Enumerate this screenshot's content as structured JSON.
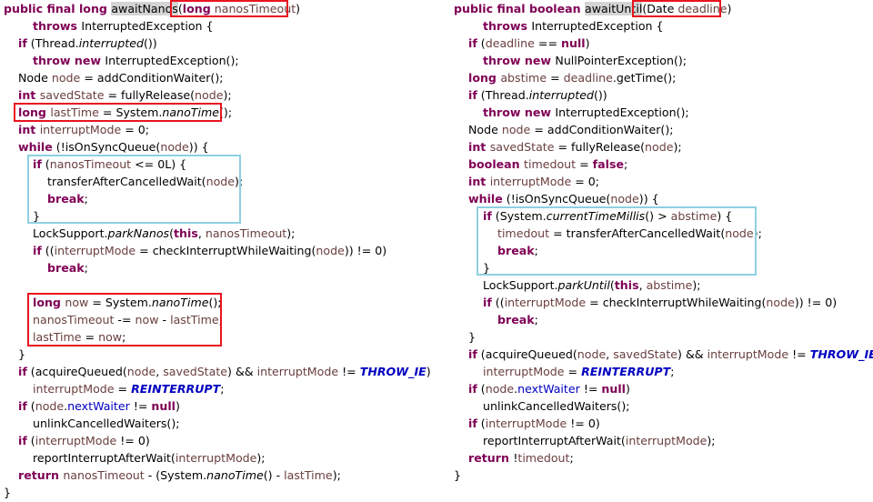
{
  "left": {
    "lines": [
      {
        "indent": 0,
        "tokens": [
          [
            "kw",
            "public final long "
          ],
          [
            "sel",
            "awaitNanos"
          ],
          [
            "",
            "("
          ],
          [
            "kw",
            "long"
          ],
          [
            "var",
            " nanosTimeout"
          ],
          [
            "",
            ")"
          ]
        ]
      },
      {
        "indent": 2,
        "tokens": [
          [
            "kw",
            "throws "
          ],
          [
            "",
            "InterruptedException {"
          ]
        ]
      },
      {
        "indent": 1,
        "tokens": [
          [
            "kw",
            "if"
          ],
          [
            "",
            " (Thread."
          ],
          [
            "it",
            "interrupted"
          ],
          [
            "",
            "())"
          ]
        ]
      },
      {
        "indent": 2,
        "tokens": [
          [
            "kw",
            "throw new "
          ],
          [
            "",
            "InterruptedException();"
          ]
        ]
      },
      {
        "indent": 1,
        "tokens": [
          [
            "",
            "Node "
          ],
          [
            "var",
            "node"
          ],
          [
            "",
            " = addConditionWaiter();"
          ]
        ]
      },
      {
        "indent": 1,
        "tokens": [
          [
            "kw",
            "int "
          ],
          [
            "var",
            "savedState"
          ],
          [
            "",
            " = fullyRelease("
          ],
          [
            "var",
            "node"
          ],
          [
            "",
            ");"
          ]
        ]
      },
      {
        "indent": 1,
        "tokens": [
          [
            "kw",
            "long "
          ],
          [
            "var",
            "lastTime"
          ],
          [
            "",
            " = System."
          ],
          [
            "it",
            "nanoTime"
          ],
          [
            "",
            "();"
          ]
        ]
      },
      {
        "indent": 1,
        "tokens": [
          [
            "kw",
            "int "
          ],
          [
            "var",
            "interruptMode"
          ],
          [
            "",
            " = 0;"
          ]
        ]
      },
      {
        "indent": 1,
        "tokens": [
          [
            "kw",
            "while"
          ],
          [
            "",
            " (!isOnSyncQueue("
          ],
          [
            "var",
            "node"
          ],
          [
            "",
            ")) {"
          ]
        ]
      },
      {
        "indent": 2,
        "tokens": [
          [
            "kw",
            "if"
          ],
          [
            "",
            " ("
          ],
          [
            "var",
            "nanosTimeout"
          ],
          [
            "",
            " <= 0L) {"
          ]
        ]
      },
      {
        "indent": 3,
        "tokens": [
          [
            "",
            "transferAfterCancelledWait("
          ],
          [
            "var",
            "node"
          ],
          [
            "",
            ");"
          ]
        ]
      },
      {
        "indent": 3,
        "tokens": [
          [
            "kw",
            "break"
          ],
          [
            "",
            ";"
          ]
        ]
      },
      {
        "indent": 2,
        "tokens": [
          [
            "",
            "}"
          ]
        ]
      },
      {
        "indent": 2,
        "tokens": [
          [
            "",
            "LockSupport."
          ],
          [
            "it",
            "parkNanos"
          ],
          [
            "",
            "("
          ],
          [
            "kw",
            "this"
          ],
          [
            "",
            ", "
          ],
          [
            "var",
            "nanosTimeout"
          ],
          [
            "",
            ");"
          ]
        ]
      },
      {
        "indent": 2,
        "tokens": [
          [
            "kw",
            "if"
          ],
          [
            "",
            " (("
          ],
          [
            "var",
            "interruptMode"
          ],
          [
            "",
            " = checkInterruptWhileWaiting("
          ],
          [
            "var",
            "node"
          ],
          [
            "",
            ")) != 0)"
          ]
        ]
      },
      {
        "indent": 3,
        "tokens": [
          [
            "kw",
            "break"
          ],
          [
            "",
            ";"
          ]
        ]
      },
      {
        "indent": 0,
        "tokens": []
      },
      {
        "indent": 2,
        "tokens": [
          [
            "kw",
            "long "
          ],
          [
            "var",
            "now"
          ],
          [
            "",
            " = System."
          ],
          [
            "it",
            "nanoTime"
          ],
          [
            "",
            "();"
          ]
        ]
      },
      {
        "indent": 2,
        "tokens": [
          [
            "var",
            "nanosTimeout"
          ],
          [
            "",
            " -= "
          ],
          [
            "var",
            "now"
          ],
          [
            "",
            " - "
          ],
          [
            "var",
            "lastTime"
          ],
          [
            "",
            ";"
          ]
        ]
      },
      {
        "indent": 2,
        "tokens": [
          [
            "var",
            "lastTime"
          ],
          [
            "",
            " = "
          ],
          [
            "var",
            "now"
          ],
          [
            "",
            ";"
          ]
        ]
      },
      {
        "indent": 1,
        "tokens": [
          [
            "",
            "}"
          ]
        ]
      },
      {
        "indent": 1,
        "tokens": [
          [
            "kw",
            "if"
          ],
          [
            "",
            " (acquireQueued("
          ],
          [
            "var",
            "node"
          ],
          [
            "",
            ", "
          ],
          [
            "var",
            "savedState"
          ],
          [
            "",
            ") && "
          ],
          [
            "var",
            "interruptMode"
          ],
          [
            "",
            " != "
          ],
          [
            "const",
            "THROW_IE"
          ],
          [
            "",
            ")"
          ]
        ]
      },
      {
        "indent": 2,
        "tokens": [
          [
            "var",
            "interruptMode"
          ],
          [
            "",
            " = "
          ],
          [
            "const",
            "REINTERRUPT"
          ],
          [
            "",
            ";"
          ]
        ]
      },
      {
        "indent": 1,
        "tokens": [
          [
            "kw",
            "if"
          ],
          [
            "",
            " ("
          ],
          [
            "var",
            "node"
          ],
          [
            "",
            "."
          ],
          [
            "fld",
            "nextWaiter"
          ],
          [
            "",
            " != "
          ],
          [
            "kw",
            "null"
          ],
          [
            "",
            ")"
          ]
        ]
      },
      {
        "indent": 2,
        "tokens": [
          [
            "",
            "unlinkCancelledWaiters();"
          ]
        ]
      },
      {
        "indent": 1,
        "tokens": [
          [
            "kw",
            "if"
          ],
          [
            "",
            " ("
          ],
          [
            "var",
            "interruptMode"
          ],
          [
            "",
            " != 0)"
          ]
        ]
      },
      {
        "indent": 2,
        "tokens": [
          [
            "",
            "reportInterruptAfterWait("
          ],
          [
            "var",
            "interruptMode"
          ],
          [
            "",
            ");"
          ]
        ]
      },
      {
        "indent": 1,
        "tokens": [
          [
            "kw",
            "return "
          ],
          [
            "var",
            "nanosTimeout"
          ],
          [
            "",
            " - (System."
          ],
          [
            "it",
            "nanoTime"
          ],
          [
            "",
            "() - "
          ],
          [
            "var",
            "lastTime"
          ],
          [
            "",
            ");"
          ]
        ]
      },
      {
        "indent": 0,
        "tokens": [
          [
            "",
            "}"
          ]
        ]
      }
    ]
  },
  "right": {
    "lines": [
      {
        "indent": 0,
        "tokens": [
          [
            "kw",
            "public final boolean "
          ],
          [
            "sel",
            "awaitUntil"
          ],
          [
            "",
            "("
          ],
          [
            "",
            "Date "
          ],
          [
            "var",
            "deadline"
          ],
          [
            "",
            ")"
          ]
        ]
      },
      {
        "indent": 2,
        "tokens": [
          [
            "kw",
            "throws "
          ],
          [
            "",
            "InterruptedException {"
          ]
        ]
      },
      {
        "indent": 1,
        "tokens": [
          [
            "kw",
            "if"
          ],
          [
            "",
            " ("
          ],
          [
            "var",
            "deadline"
          ],
          [
            "",
            " == "
          ],
          [
            "kw",
            "null"
          ],
          [
            "",
            ")"
          ]
        ]
      },
      {
        "indent": 2,
        "tokens": [
          [
            "kw",
            "throw new "
          ],
          [
            "",
            "NullPointerException();"
          ]
        ]
      },
      {
        "indent": 1,
        "tokens": [
          [
            "kw",
            "long "
          ],
          [
            "var",
            "abstime"
          ],
          [
            "",
            " = "
          ],
          [
            "var",
            "deadline"
          ],
          [
            "",
            ".getTime();"
          ]
        ]
      },
      {
        "indent": 1,
        "tokens": [
          [
            "kw",
            "if"
          ],
          [
            "",
            " (Thread."
          ],
          [
            "it",
            "interrupted"
          ],
          [
            "",
            "())"
          ]
        ]
      },
      {
        "indent": 2,
        "tokens": [
          [
            "kw",
            "throw new "
          ],
          [
            "",
            "InterruptedException();"
          ]
        ]
      },
      {
        "indent": 1,
        "tokens": [
          [
            "",
            "Node "
          ],
          [
            "var",
            "node"
          ],
          [
            "",
            " = addConditionWaiter();"
          ]
        ]
      },
      {
        "indent": 1,
        "tokens": [
          [
            "kw",
            "int "
          ],
          [
            "var",
            "savedState"
          ],
          [
            "",
            " = fullyRelease("
          ],
          [
            "var",
            "node"
          ],
          [
            "",
            ");"
          ]
        ]
      },
      {
        "indent": 1,
        "tokens": [
          [
            "kw",
            "boolean "
          ],
          [
            "var",
            "timedout"
          ],
          [
            "",
            " = "
          ],
          [
            "kw",
            "false"
          ],
          [
            "",
            ";"
          ]
        ]
      },
      {
        "indent": 1,
        "tokens": [
          [
            "kw",
            "int "
          ],
          [
            "var",
            "interruptMode"
          ],
          [
            "",
            " = 0;"
          ]
        ]
      },
      {
        "indent": 1,
        "tokens": [
          [
            "kw",
            "while"
          ],
          [
            "",
            " (!isOnSyncQueue("
          ],
          [
            "var",
            "node"
          ],
          [
            "",
            ")) {"
          ]
        ]
      },
      {
        "indent": 2,
        "tokens": [
          [
            "kw",
            "if"
          ],
          [
            "",
            " (System."
          ],
          [
            "it",
            "currentTimeMillis"
          ],
          [
            "",
            "() > "
          ],
          [
            "var",
            "abstime"
          ],
          [
            "",
            ") {"
          ]
        ]
      },
      {
        "indent": 3,
        "tokens": [
          [
            "var",
            "timedout"
          ],
          [
            "",
            " = transferAfterCancelledWait("
          ],
          [
            "var",
            "node"
          ],
          [
            "",
            ");"
          ]
        ]
      },
      {
        "indent": 3,
        "tokens": [
          [
            "kw",
            "break"
          ],
          [
            "",
            ";"
          ]
        ]
      },
      {
        "indent": 2,
        "tokens": [
          [
            "",
            "}"
          ]
        ]
      },
      {
        "indent": 2,
        "tokens": [
          [
            "",
            "LockSupport."
          ],
          [
            "it",
            "parkUntil"
          ],
          [
            "",
            "("
          ],
          [
            "kw",
            "this"
          ],
          [
            "",
            ", "
          ],
          [
            "var",
            "abstime"
          ],
          [
            "",
            ");"
          ]
        ]
      },
      {
        "indent": 2,
        "tokens": [
          [
            "kw",
            "if"
          ],
          [
            "",
            " (("
          ],
          [
            "var",
            "interruptMode"
          ],
          [
            "",
            " = checkInterruptWhileWaiting("
          ],
          [
            "var",
            "node"
          ],
          [
            "",
            ")) != 0)"
          ]
        ]
      },
      {
        "indent": 3,
        "tokens": [
          [
            "kw",
            "break"
          ],
          [
            "",
            ";"
          ]
        ]
      },
      {
        "indent": 1,
        "tokens": [
          [
            "",
            "}"
          ]
        ]
      },
      {
        "indent": 1,
        "tokens": [
          [
            "kw",
            "if"
          ],
          [
            "",
            " (acquireQueued("
          ],
          [
            "var",
            "node"
          ],
          [
            "",
            ", "
          ],
          [
            "var",
            "savedState"
          ],
          [
            "",
            ") && "
          ],
          [
            "var",
            "interruptMode"
          ],
          [
            "",
            " != "
          ],
          [
            "const",
            "THROW_IE"
          ],
          [
            "",
            ")"
          ]
        ]
      },
      {
        "indent": 2,
        "tokens": [
          [
            "var",
            "interruptMode"
          ],
          [
            "",
            " = "
          ],
          [
            "const",
            "REINTERRUPT"
          ],
          [
            "",
            ";"
          ]
        ]
      },
      {
        "indent": 1,
        "tokens": [
          [
            "kw",
            "if"
          ],
          [
            "",
            " ("
          ],
          [
            "var",
            "node"
          ],
          [
            "",
            "."
          ],
          [
            "fld",
            "nextWaiter"
          ],
          [
            "",
            " != "
          ],
          [
            "kw",
            "null"
          ],
          [
            "",
            ")"
          ]
        ]
      },
      {
        "indent": 2,
        "tokens": [
          [
            "",
            "unlinkCancelledWaiters();"
          ]
        ]
      },
      {
        "indent": 1,
        "tokens": [
          [
            "kw",
            "if"
          ],
          [
            "",
            " ("
          ],
          [
            "var",
            "interruptMode"
          ],
          [
            "",
            " != 0)"
          ]
        ]
      },
      {
        "indent": 2,
        "tokens": [
          [
            "",
            "reportInterruptAfterWait("
          ],
          [
            "var",
            "interruptMode"
          ],
          [
            "",
            ");"
          ]
        ]
      },
      {
        "indent": 1,
        "tokens": [
          [
            "kw",
            "return "
          ],
          [
            "",
            "!"
          ],
          [
            "var",
            "timedout"
          ],
          [
            "",
            ";"
          ]
        ]
      },
      {
        "indent": 0,
        "tokens": [
          [
            "",
            "}"
          ]
        ]
      }
    ]
  },
  "colors": {
    "keyword": "#7f0055",
    "variable": "#6a3e3e",
    "field": "#0000c0",
    "highlight_red": "#e8141f",
    "highlight_blue": "#8fd0e2",
    "selection": "#d4d4d4"
  }
}
